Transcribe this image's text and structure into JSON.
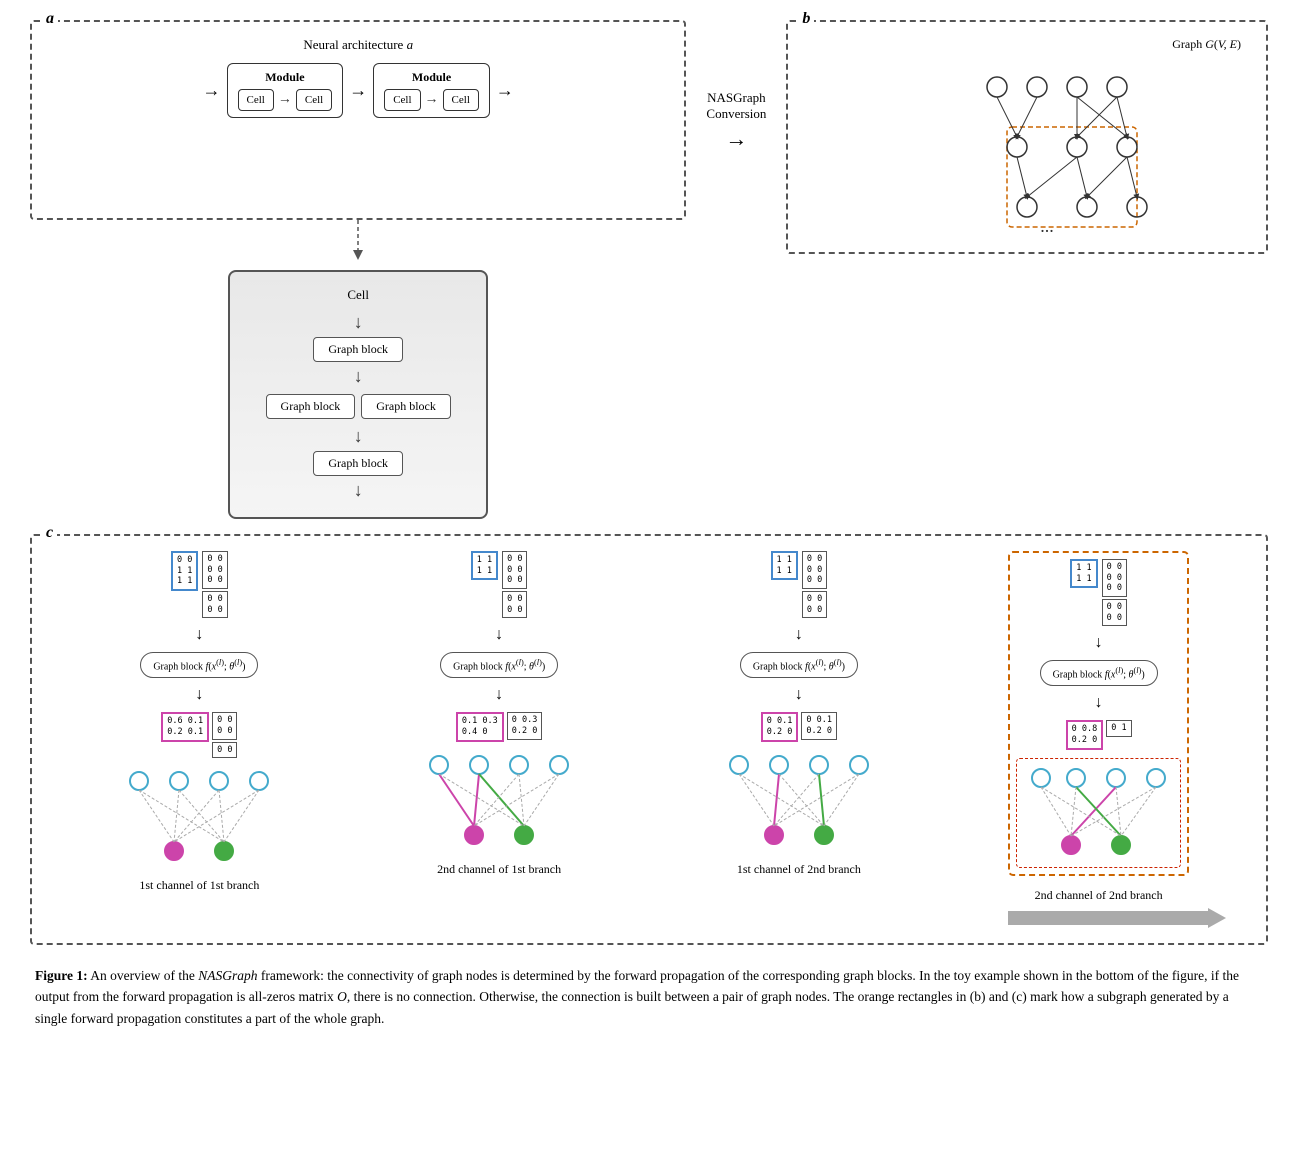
{
  "figure": {
    "label": "Figure 1:",
    "caption_parts": [
      "An overview of the ",
      "NASGraph",
      " framework: the connectivity of graph nodes is determined by the forward propagation of the corresponding graph blocks. In the toy example shown in the bottom of the figure, if the output from the forward propagation is all-zeros matrix ",
      "O",
      ", there is no connection. Otherwise, the connection is built between a pair of graph nodes. The orange rectangles in (b) and (c) mark how a subgraph generated by a single forward propagation constitutes a part of the whole graph."
    ]
  },
  "panel_a": {
    "label": "a",
    "title": "Neural architecture a",
    "module_label": "Module",
    "cell_label": "Cell",
    "conversion_label": "NASGraph\nConversion"
  },
  "panel_b": {
    "label": "b",
    "graph_label": "Graph G(V, E)"
  },
  "panel_c": {
    "label": "c",
    "channels": [
      {
        "label": "1st channel of 1st branch",
        "highlighted": false
      },
      {
        "label": "2nd channel of 1st branch",
        "highlighted": false
      },
      {
        "label": "1st channel of 2nd branch",
        "highlighted": false
      },
      {
        "label": "2nd channel of 2nd branch",
        "highlighted": true
      }
    ]
  },
  "cell_detail": {
    "label": "Cell",
    "graph_blocks": [
      "Graph block",
      "Graph block",
      "Graph block",
      "Graph block"
    ]
  },
  "graph_block_fn": "Graph block f(x(l); θ(l))"
}
